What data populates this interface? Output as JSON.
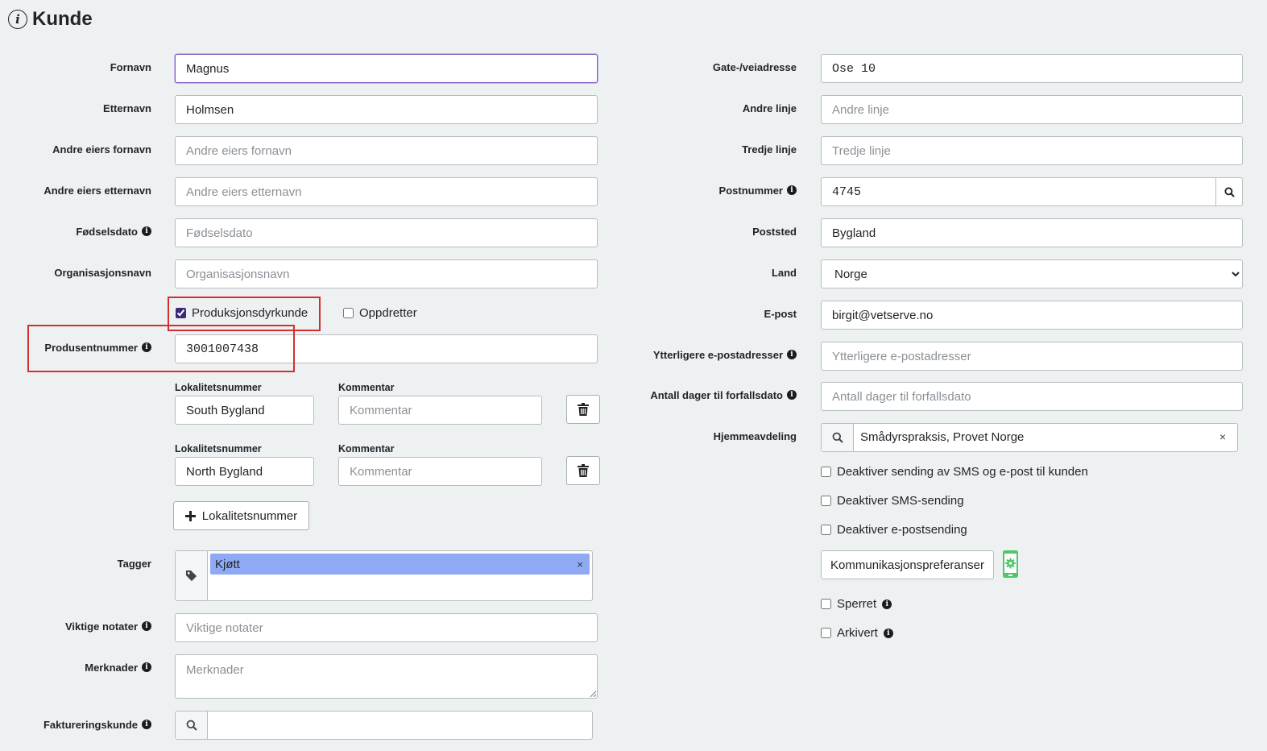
{
  "page": {
    "title": "Kunde"
  },
  "left": {
    "fornavn": {
      "label": "Fornavn",
      "value": "Magnus"
    },
    "etternavn": {
      "label": "Etternavn",
      "value": "Holmsen"
    },
    "andre_fornavn": {
      "label": "Andre eiers fornavn",
      "placeholder": "Andre eiers fornavn"
    },
    "andre_etternavn": {
      "label": "Andre eiers etternavn",
      "placeholder": "Andre eiers etternavn"
    },
    "fodselsdato": {
      "label": "Fødselsdato",
      "placeholder": "Fødselsdato"
    },
    "organisasjonsnavn": {
      "label": "Organisasjonsnavn",
      "placeholder": "Organisasjonsnavn"
    },
    "produksjonsdyrkunde": {
      "label": "Produksjonsdyrkunde",
      "checked": true
    },
    "oppdretter": {
      "label": "Oppdretter",
      "checked": false
    },
    "produsentnummer": {
      "label": "Produsentnummer",
      "value": "3001007438"
    },
    "lokaliteter": [
      {
        "lok_label": "Lokalitetsnummer",
        "lok_value": "South Bygland",
        "kom_label": "Kommentar",
        "kom_placeholder": "Kommentar"
      },
      {
        "lok_label": "Lokalitetsnummer",
        "lok_value": "North Bygland",
        "kom_label": "Kommentar",
        "kom_placeholder": "Kommentar"
      }
    ],
    "add_lokalitet": "Lokalitetsnummer",
    "tagger": {
      "label": "Tagger",
      "tags": [
        "Kjøtt"
      ]
    },
    "viktige_notater": {
      "label": "Viktige notater",
      "placeholder": "Viktige notater"
    },
    "merknader": {
      "label": "Merknader",
      "placeholder": "Merknader"
    },
    "faktureringskunde": {
      "label": "Faktureringskunde",
      "value": ""
    }
  },
  "right": {
    "gate": {
      "label": "Gate-/veiadresse",
      "value": "Ose 10"
    },
    "andre_linje": {
      "label": "Andre linje",
      "placeholder": "Andre linje"
    },
    "tredje_linje": {
      "label": "Tredje linje",
      "placeholder": "Tredje linje"
    },
    "postnummer": {
      "label": "Postnummer",
      "value": "4745"
    },
    "poststed": {
      "label": "Poststed",
      "value": "Bygland"
    },
    "land": {
      "label": "Land",
      "value": "Norge"
    },
    "epost": {
      "label": "E-post",
      "value": "birgit@vetserve.no"
    },
    "ytterligere_epost": {
      "label": "Ytterligere e-postadresser",
      "placeholder": "Ytterligere e-postadresser"
    },
    "antall_dager": {
      "label": "Antall dager til forfallsdato",
      "placeholder": "Antall dager til forfallsdato"
    },
    "hjemmeavdeling": {
      "label": "Hjemmeavdeling",
      "value": "Smådyrspraksis, Provet Norge"
    },
    "deaktiver_begge": {
      "label": "Deaktiver sending av SMS og e-post til kunden",
      "checked": false
    },
    "deaktiver_sms": {
      "label": "Deaktiver SMS-sending",
      "checked": false
    },
    "deaktiver_epost": {
      "label": "Deaktiver e-postsending",
      "checked": false
    },
    "kommunikasjon_button": "Kommunikasjonspreferanser",
    "sperret": {
      "label": "Sperret",
      "checked": false
    },
    "arkivert": {
      "label": "Arkivert",
      "checked": false
    }
  },
  "colors": {
    "accent": "#7e57c2",
    "tag_bg": "#8fa9f5",
    "highlight": "#d32f2f",
    "phone_icon": "#4cc76a"
  }
}
